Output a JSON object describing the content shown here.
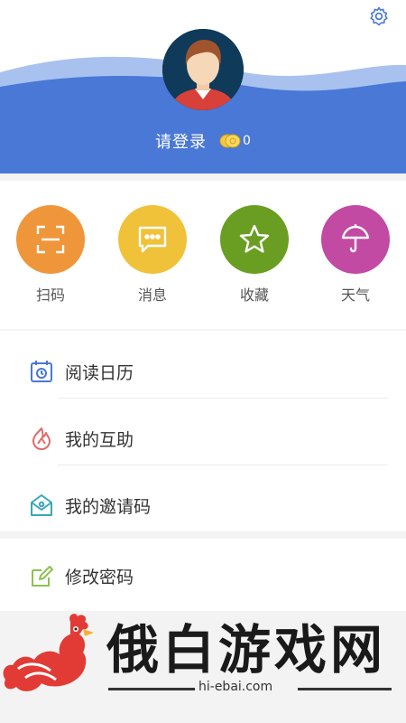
{
  "header": {
    "login_label": "请登录",
    "coin_count": "0",
    "settings_icon": "gear-icon",
    "avatar_icon": "user-avatar",
    "wave_color": "#4a78d6"
  },
  "quick_actions": [
    {
      "label": "扫码",
      "icon": "scan-icon",
      "color": "#f0963a"
    },
    {
      "label": "消息",
      "icon": "message-icon",
      "color": "#f0c23a"
    },
    {
      "label": "收藏",
      "icon": "star-icon",
      "color": "#6a9e22"
    },
    {
      "label": "天气",
      "icon": "umbrella-icon",
      "color": "#c24aa2"
    }
  ],
  "menu": [
    {
      "label": "阅读日历",
      "icon": "calendar-icon"
    },
    {
      "label": "我的互助",
      "icon": "flame-icon"
    },
    {
      "label": "我的邀请码",
      "icon": "invite-envelope-icon"
    },
    {
      "label": "修改密码",
      "icon": "edit-password-icon"
    }
  ],
  "watermark": {
    "name": "俄白游戏网",
    "url": "hi-ebai.com",
    "logo_icon": "rooster-logo"
  }
}
